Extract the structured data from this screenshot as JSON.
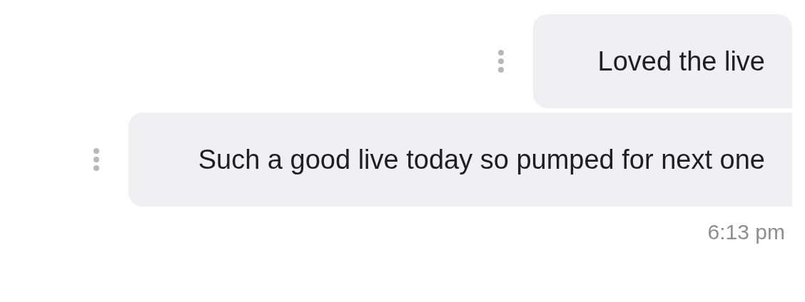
{
  "messages": [
    {
      "text": "Loved the live",
      "has_menu": true
    },
    {
      "text": "Such a good live today so pumped for next one",
      "has_menu": true
    }
  ],
  "timestamp": "6:13 pm"
}
